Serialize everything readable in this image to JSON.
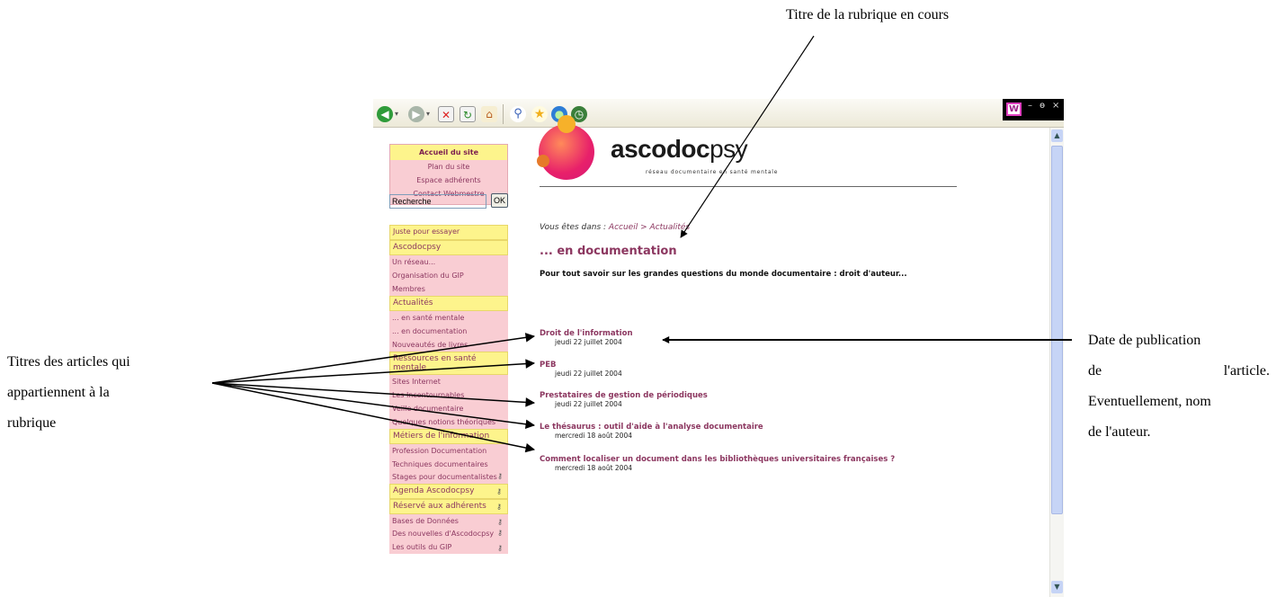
{
  "annotations": {
    "top": "Titre de la rubrique en cours",
    "left": [
      "Titres des articles qui",
      "appartiennent à la",
      "rubrique"
    ],
    "right": [
      "Date de publication",
      "de",
      "l'article.",
      "Eventuellement, nom",
      "de l'auteur."
    ]
  },
  "window": {
    "logo_letter": "W",
    "minimize": "–",
    "restore": "ɵ",
    "close": "×"
  },
  "top_menu": {
    "home": "Accueil du site",
    "links": [
      "Plan du site",
      "Espace adhérents",
      "Contact Webmestre"
    ]
  },
  "search": {
    "value": "Recherche",
    "button": "OK"
  },
  "nav": {
    "just_try": "Juste pour essayer",
    "ascodocpsy": {
      "head": "Ascodocpsy",
      "items": [
        "Un réseau...",
        "Organisation du GIP",
        "Membres"
      ]
    },
    "actualites": {
      "head": "Actualités",
      "items": [
        "... en santé mentale",
        "... en documentation",
        "Nouveautés de livres"
      ]
    },
    "ressources": {
      "head": "Ressources en santé mentale",
      "items": [
        "Sites Internet",
        "Les Incontournables",
        "Veille documentaire",
        "Quelques notions théoriques"
      ]
    },
    "metiers": {
      "head": "Métiers de l'information",
      "items": [
        "Profession Documentation",
        "Techniques documentaires",
        "Stages pour documentalistes"
      ]
    },
    "agenda": "Agenda Ascodocpsy",
    "reserve": {
      "head": "Réservé aux adhérents",
      "items": [
        "Bases de Données",
        "Des nouvelles d'Ascodocpsy",
        "Les outils du GIP"
      ]
    }
  },
  "banner": {
    "logo_bold": "ascodoc",
    "logo_light": "psy",
    "tagline": "réseau documentaire en santé mentale"
  },
  "breadcrumb": {
    "prefix": "Vous êtes dans : ",
    "home": "Accueil",
    "sep": " > ",
    "current": "Actualités"
  },
  "rubric": {
    "title": "... en documentation",
    "description": "Pour tout savoir sur les grandes questions du monde documentaire : droit d'auteur..."
  },
  "articles": [
    {
      "title": "Droit de l'information",
      "date": "jeudi 22 juillet 2004"
    },
    {
      "title": "PEB",
      "date": "jeudi 22 juillet 2004"
    },
    {
      "title": "Prestataires de gestion de périodiques",
      "date": "jeudi 22 juillet 2004"
    },
    {
      "title": "Le thésaurus : outil d'aide à l'analyse documentaire",
      "date": "mercredi 18 août 2004"
    },
    {
      "title": "Comment localiser un document dans les bibliothèques universitaires françaises ?",
      "date": "mercredi 18 août 2004"
    }
  ],
  "icons": [
    "back-icon",
    "forward-icon",
    "stop-icon",
    "refresh-icon",
    "home-icon",
    "search-icon",
    "favorites-icon",
    "media-icon",
    "history-icon",
    "key-icon"
  ],
  "colors": {
    "menu_pink": "#f9cdd3",
    "menu_yellow": "#fdf48c",
    "link_purple": "#8c3760",
    "scrollbar_blue": "#c6d4f6"
  }
}
